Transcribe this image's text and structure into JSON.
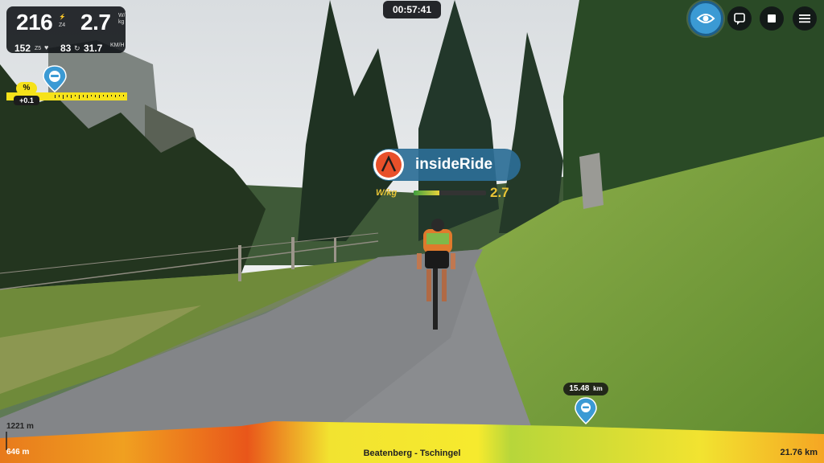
{
  "stats": {
    "power": "216",
    "power_zone": "Z4",
    "wkg": "2.7",
    "wkg_unit": "W/kg",
    "heart_rate": "152",
    "hr_zone": "Z5",
    "cadence": "83",
    "speed": "31.7",
    "speed_unit": "KM/H"
  },
  "timer": "00:57:41",
  "gradient": {
    "symbol": "%",
    "value": "+0.1"
  },
  "rider": {
    "name": "insideRide",
    "wkg_label": "W/kg",
    "wkg_value": "2.7",
    "wkg_level": 0.36
  },
  "route": {
    "name": "Beatenberg - Tschingel",
    "elevation_max": "1221 m",
    "elevation_min": "646 m",
    "total_distance": "21.76 km",
    "position_km": "15.48",
    "position_unit": "km"
  },
  "icons": [
    "heart-icon",
    "cadence-icon",
    "eye-icon",
    "chat-icon",
    "stop-icon",
    "menu-icon",
    "rider-avatar-icon"
  ],
  "colors": {
    "accent_blue": "#3b9ad4",
    "grade_yellow": "#f6e21a",
    "wkg_gold": "#e8c436"
  }
}
